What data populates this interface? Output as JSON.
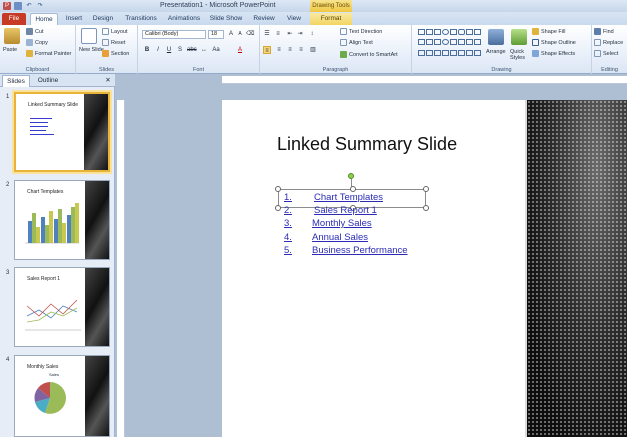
{
  "window": {
    "title": "Presentation1 - Microsoft PowerPoint",
    "contextual_tab_group": "Drawing Tools"
  },
  "tabs": [
    "File",
    "Home",
    "Insert",
    "Design",
    "Transitions",
    "Animations",
    "Slide Show",
    "Review",
    "View",
    "Format"
  ],
  "ribbon": {
    "clipboard": {
      "label": "Clipboard",
      "paste": "Paste",
      "cut": "Cut",
      "copy": "Copy",
      "format_painter": "Format Painter"
    },
    "slides": {
      "label": "Slides",
      "new_slide": "New Slide",
      "layout": "Layout",
      "reset": "Reset",
      "section": "Section"
    },
    "font": {
      "label": "Font",
      "font_name": "Calibri (Body)",
      "font_size": "18"
    },
    "paragraph": {
      "label": "Paragraph",
      "text_direction": "Text Direction",
      "align_text": "Align Text",
      "convert_smartart": "Convert to SmartArt"
    },
    "drawing": {
      "label": "Drawing",
      "arrange": "Arrange",
      "quick_styles": "Quick Styles",
      "shape_fill": "Shape Fill",
      "shape_outline": "Shape Outline",
      "shape_effects": "Shape Effects"
    },
    "editing": {
      "label": "Editing",
      "find": "Find",
      "replace": "Replace",
      "select": "Select"
    }
  },
  "left_panel": {
    "tabs": [
      "Slides",
      "Outline"
    ]
  },
  "thumbnails": [
    {
      "num": "1",
      "title": "Linked Summary Slide"
    },
    {
      "num": "2",
      "title": "Chart Templates"
    },
    {
      "num": "3",
      "title": "Sales Report 1"
    },
    {
      "num": "4",
      "title": "Monthly Sales",
      "chart_title": "Sales"
    }
  ],
  "slide": {
    "title": "Linked Summary Slide",
    "items": [
      {
        "num": "1.",
        "text": "Chart Templates"
      },
      {
        "num": "2.",
        "text": "Sales Report 1"
      },
      {
        "num": "3.",
        "text": "Monthly Sales"
      },
      {
        "num": "4.",
        "text": "Annual Sales"
      },
      {
        "num": "5.",
        "text": "Business Performance"
      }
    ]
  },
  "colors": {
    "file_tab": "#c73a26",
    "contextual": "#f0c742",
    "link": "#2b2bb6",
    "selection": "#e8b33a"
  }
}
